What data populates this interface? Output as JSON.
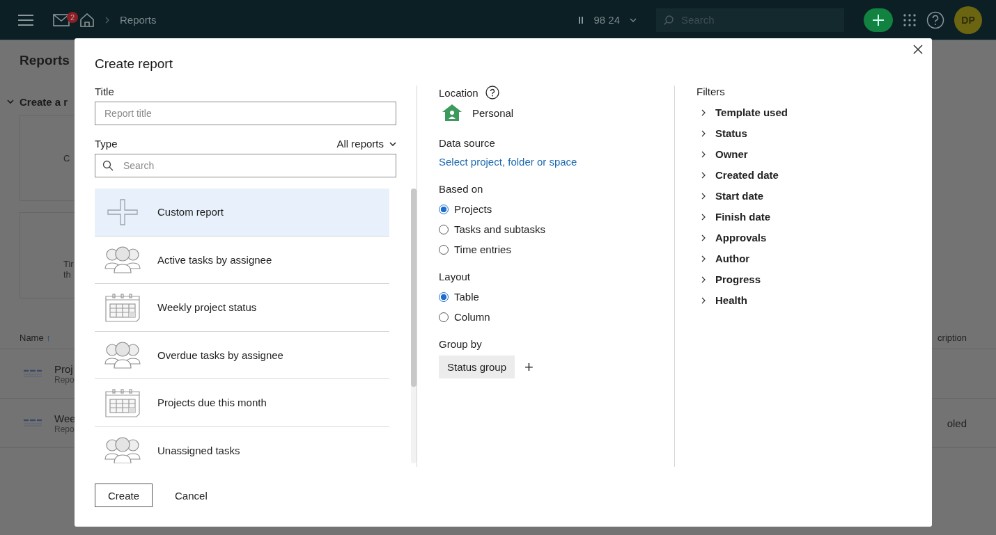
{
  "topbar": {
    "mail_badge": "2",
    "breadcrumb": "Reports",
    "timer": "98 24",
    "search_placeholder": "Search",
    "avatar": "DP"
  },
  "background": {
    "page_title": "Reports",
    "section": "Create a r",
    "cards": [
      {
        "lines": [
          "C"
        ]
      },
      {
        "lines": [
          "Tir",
          "th"
        ]
      }
    ],
    "name_column": "Name",
    "sort_arrow": "↑",
    "column_3": "cription",
    "rows": [
      {
        "name": "Proj",
        "subtitle": "Repo"
      },
      {
        "name": "Wee",
        "subtitle": "Repo",
        "column_3": "oled"
      }
    ]
  },
  "dialog": {
    "title": "Create report",
    "title_label": "Title",
    "title_placeholder": "Report title",
    "type_label": "Type",
    "type_filter": "All reports",
    "search_placeholder": "Search",
    "templates": [
      {
        "kind": "plus",
        "label": "Custom report",
        "selected": true
      },
      {
        "kind": "people",
        "label": "Active tasks by assignee",
        "selected": false
      },
      {
        "kind": "calendar",
        "label": "Weekly project status",
        "selected": false
      },
      {
        "kind": "people",
        "label": "Overdue tasks by assignee",
        "selected": false
      },
      {
        "kind": "calendar",
        "label": "Projects due this month",
        "selected": false
      },
      {
        "kind": "people",
        "label": "Unassigned tasks",
        "selected": false
      }
    ],
    "location_label": "Location",
    "location": "Personal",
    "data_source_label": "Data source",
    "data_source_link": "Select project, folder or space",
    "based_on_label": "Based on",
    "based_on": [
      {
        "label": "Projects",
        "selected": true
      },
      {
        "label": "Tasks and subtasks",
        "selected": false
      },
      {
        "label": "Time entries",
        "selected": false
      }
    ],
    "layout_label": "Layout",
    "layout": [
      {
        "label": "Table",
        "selected": true
      },
      {
        "label": "Column",
        "selected": false
      }
    ],
    "group_by_label": "Group by",
    "group_by": "Status group",
    "group_add": "+",
    "filters_label": "Filters",
    "filters": [
      "Template used",
      "Status",
      "Owner",
      "Created date",
      "Start date",
      "Finish date",
      "Approvals",
      "Author",
      "Progress",
      "Health"
    ],
    "buttons": [
      "Create",
      "Cancel"
    ]
  }
}
